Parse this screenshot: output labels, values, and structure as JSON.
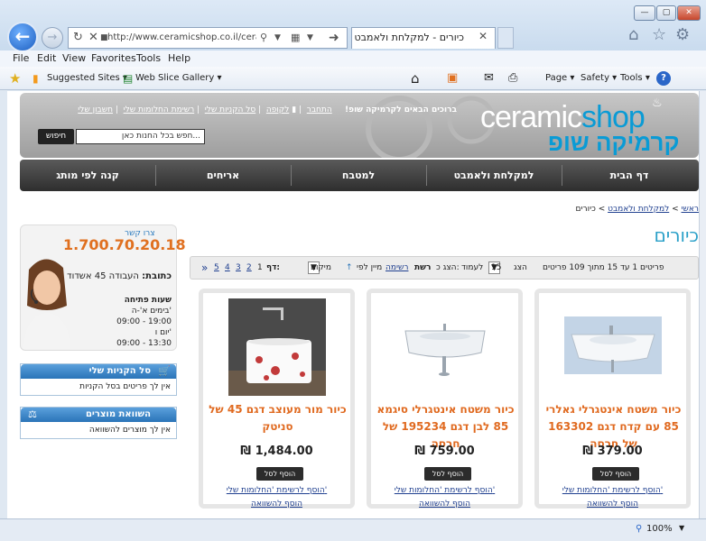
{
  "browser": {
    "url": "http://www.ceramicshop.co.il/ceramic-sh",
    "tab_title": "כיורים - למקלחת ולאמבט",
    "menu": [
      "File",
      "Edit",
      "View",
      "Favorites",
      "Tools",
      "Help"
    ],
    "favorites": {
      "suggested": "Suggested Sites ▾",
      "webslice": "Web Slice Gallery ▾"
    },
    "command": {
      "page": "Page ▾",
      "safety": "Safety ▾",
      "tools": "Tools ▾"
    },
    "zoom": "100%",
    "window_buttons": [
      "—",
      "▢",
      "✕"
    ]
  },
  "header": {
    "logo_part1": "ceramic",
    "logo_part2": "shop",
    "logo_hebrew": "קרמיקה שופ",
    "welcome": "ברוכים הבאים לקרמיקה שופ!",
    "links": [
      "התחבר",
      "לקופה",
      "סל הקניות שלי",
      "רשימת החלומות שלי",
      "חשבון שלי"
    ],
    "search_placeholder": "חפש בכל החנות כאן...",
    "search_button": "חיפוש"
  },
  "nav": [
    "דף הבית",
    "למקלחת ולאמבט",
    "למטבח",
    "אריחים",
    "קנה לפי מותג"
  ],
  "breadcrumb": {
    "home": "ראשי",
    "category": "למקלחת ולאמבט",
    "current": "כיורים"
  },
  "page_title": "כיורים",
  "sidebar": {
    "contact_label": "צרו קשר",
    "phone": "1.700.70.20.18",
    "address_label": "כתובת:",
    "address": "העבודה 45 אשדוד",
    "hours_title": "שעות פתיחה",
    "hours": [
      "בימים א'-ה'",
      "09:00 - 19:00",
      "יום ו'",
      "09:00 - 13:30"
    ],
    "cart_title": "סל הקניות שלי",
    "cart_empty": "אין לך פריטים בסל הקניות",
    "compare_title": "השוואת מוצרים",
    "compare_empty": "אין לך מוצרים להשוואה"
  },
  "toolbar": {
    "items_info": "פריטים 1 עד 15 מתוך 109 פריטים",
    "show_label": "הצג",
    "per_page": "15",
    "per_page_suffix": "לעמוד",
    "view_label": "הצג כ:",
    "view_grid": "רשת",
    "view_list": "רשימה",
    "sort_label": "מיין לפי",
    "sort_value": "מיקום",
    "page_label": "דף:",
    "pages": [
      "1",
      "2",
      "3",
      "4",
      "5"
    ],
    "next": "»"
  },
  "products": [
    {
      "name": "כיור משטח אינטגרלי גאלרי 85 עם קדח דגם 163302 של חרסה",
      "price": "379.00 ₪",
      "add": "הוסף לסל",
      "wish": "הוסף לרשימת 'החלומות שלי'",
      "compare": "הוסף להשוואה"
    },
    {
      "name": "כיור משטח אינטגרלי סיגמא 85 לבן דגם 195234 של חרסה",
      "price": "759.00 ₪",
      "add": "הוסף לסל",
      "wish": "הוסף לרשימת 'החלומות שלי'",
      "compare": "הוסף להשוואה"
    },
    {
      "name": "כיור מור מעוצב דגם 45 של סניטק",
      "price": "1,484.00 ₪",
      "add": "הוסף לסל",
      "wish": "הוסף לרשימת 'החלומות שלי'",
      "compare": "הוסף להשוואה"
    }
  ],
  "colors": {
    "accent": "#e06a20",
    "brand": "#0a9bd5",
    "title": "#2aa0c8"
  }
}
